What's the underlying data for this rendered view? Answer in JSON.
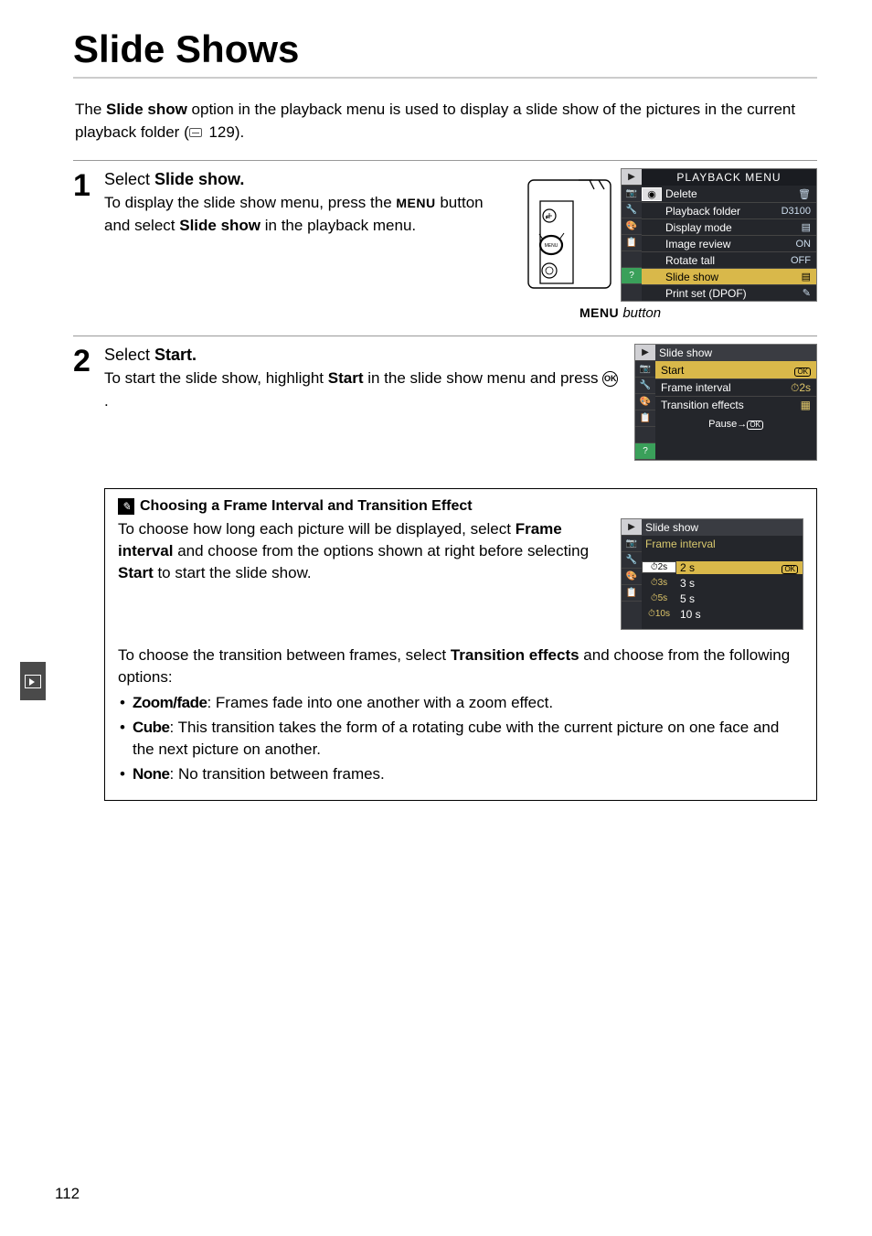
{
  "page_title": "Slide Shows",
  "intro_pre": "The ",
  "intro_bold": "Slide show",
  "intro_post": " option in the playback menu is used to display a slide show of the pictures in the current playback folder (",
  "intro_ref": " 129).",
  "step1": {
    "num": "1",
    "head_pre": "Select ",
    "head_bold": "Slide show.",
    "body_pre": "To display the slide show menu, press the ",
    "body_menu": "MENU",
    "body_mid": " button and select ",
    "body_bold": "Slide show",
    "body_post": " in the playback menu.",
    "caption_menu": "MENU",
    "caption_ital": " button"
  },
  "lcd1": {
    "title": "PLAYBACK MENU",
    "items": [
      {
        "label": "Delete",
        "val": "🗑"
      },
      {
        "label": "Playback folder",
        "val": "D3100"
      },
      {
        "label": "Display mode",
        "val": "▤"
      },
      {
        "label": "Image review",
        "val": "ON"
      },
      {
        "label": "Rotate tall",
        "val": "OFF"
      },
      {
        "label": "Slide show",
        "val": "▤"
      },
      {
        "label": "Print set (DPOF)",
        "val": "✎"
      }
    ]
  },
  "step2": {
    "num": "2",
    "head_pre": "Select ",
    "head_bold": "Start.",
    "body_pre": "To start the slide show, highlight ",
    "body_bold": "Start",
    "body_mid": " in the slide show menu and press ",
    "body_post": "."
  },
  "lcd2": {
    "title": "Slide show",
    "items": [
      {
        "label": "Start",
        "val": "OK",
        "selected": true
      },
      {
        "label": "Frame interval",
        "val": "⏱2s"
      },
      {
        "label": "Transition effects",
        "val": "▦"
      }
    ],
    "pause": "Pause→",
    "pause_ok": "OK"
  },
  "note": {
    "title": "Choosing a Frame Interval and Transition Effect",
    "p1_pre": "To choose how long each picture will be displayed, select ",
    "p1_bold": "Frame interval",
    "p1_mid": " and choose from the options shown at right before selecting ",
    "p1_bold2": "Start",
    "p1_post": " to start the slide show.",
    "p2_pre": "To choose the transition between frames, select ",
    "p2_bold": "Transition effects",
    "p2_post": " and choose from the following options:",
    "bullets": [
      {
        "head": "Zoom/fade",
        "body": ": Frames fade into one another with a zoom effect."
      },
      {
        "head": "Cube",
        "body": ": This transition takes the form of a rotating cube with the current picture on one face and the next picture on another."
      },
      {
        "head": "None",
        "body": ": No transition between frames."
      }
    ]
  },
  "lcd3": {
    "title": "Slide show",
    "sub": "Frame interval",
    "items": [
      {
        "pre": "⏱2s",
        "label": "2 s",
        "selected": true,
        "ok": "OK"
      },
      {
        "pre": "⏱3s",
        "label": "3 s"
      },
      {
        "pre": "⏱5s",
        "label": "5 s"
      },
      {
        "pre": "⏱10s",
        "label": "10 s"
      }
    ]
  },
  "page_number": "112"
}
